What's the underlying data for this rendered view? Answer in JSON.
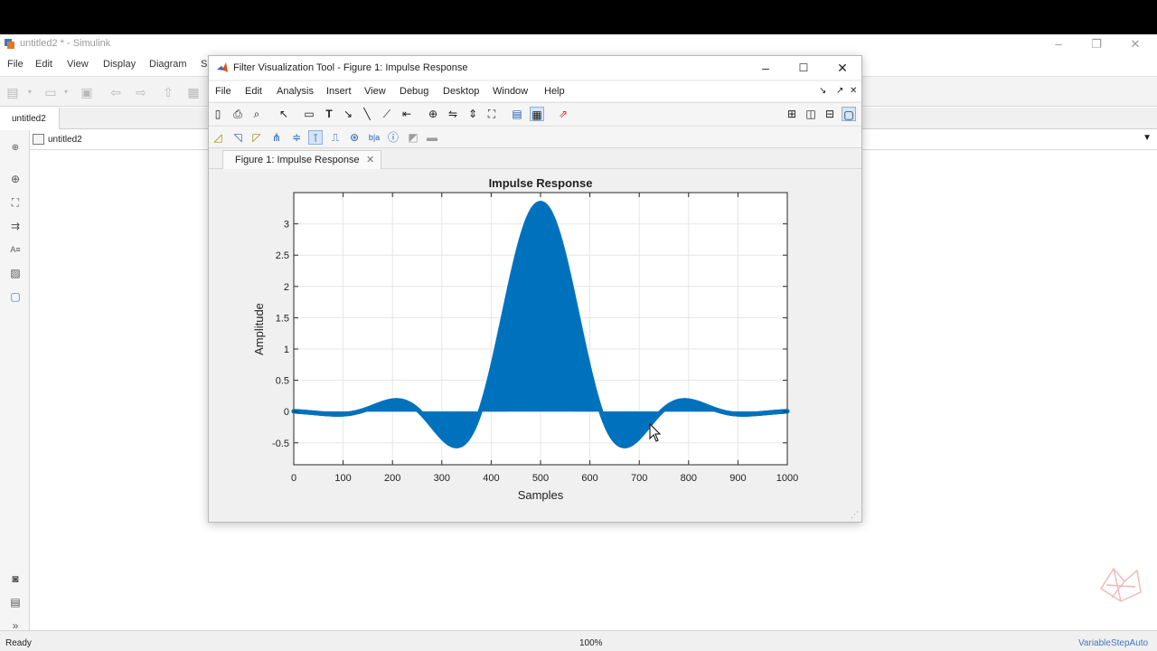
{
  "simulink": {
    "title": "untitled2 * - Simulink",
    "menu": [
      "File",
      "Edit",
      "View",
      "Display",
      "Diagram",
      "S"
    ],
    "tab": "untitled2",
    "address": "untitled2",
    "status_left": "Ready",
    "status_zoom": "100%",
    "status_solver": "VariableStepAuto"
  },
  "fvtool": {
    "title": "Filter Visualization Tool - Figure 1: Impulse Response",
    "menu": [
      "File",
      "Edit",
      "Analysis",
      "Insert",
      "View",
      "Debug",
      "Desktop",
      "Window",
      "Help"
    ],
    "tab_label": "Figure 1: Impulse Response"
  },
  "chart_data": {
    "type": "stem",
    "title": "Impulse Response",
    "xlabel": "Samples",
    "ylabel": "Amplitude",
    "xlim": [
      0,
      1000
    ],
    "ylim": [
      -0.85,
      3.5
    ],
    "xticks": [
      0,
      100,
      200,
      300,
      400,
      500,
      600,
      700,
      800,
      900,
      1000
    ],
    "yticks": [
      -0.5,
      0,
      0.5,
      1,
      1.5,
      2,
      2.5,
      3
    ],
    "ytick_labels": [
      "-0.5",
      "0",
      "0.5",
      "1",
      "1.5",
      "2",
      "2.5",
      "3"
    ],
    "grid": true,
    "color": "#0072bd",
    "envelope": {
      "description_free_samples": true,
      "center": 500,
      "peak": 3.33,
      "period": 245
    },
    "series": [
      {
        "x": [
          0,
          60,
          150,
          260,
          360,
          500,
          640,
          745,
          850,
          1000
        ],
        "values": [
          0,
          0.1,
          -0.2,
          0.38,
          -0.67,
          3.33,
          -0.67,
          0.38,
          -0.2,
          0
        ]
      }
    ]
  }
}
